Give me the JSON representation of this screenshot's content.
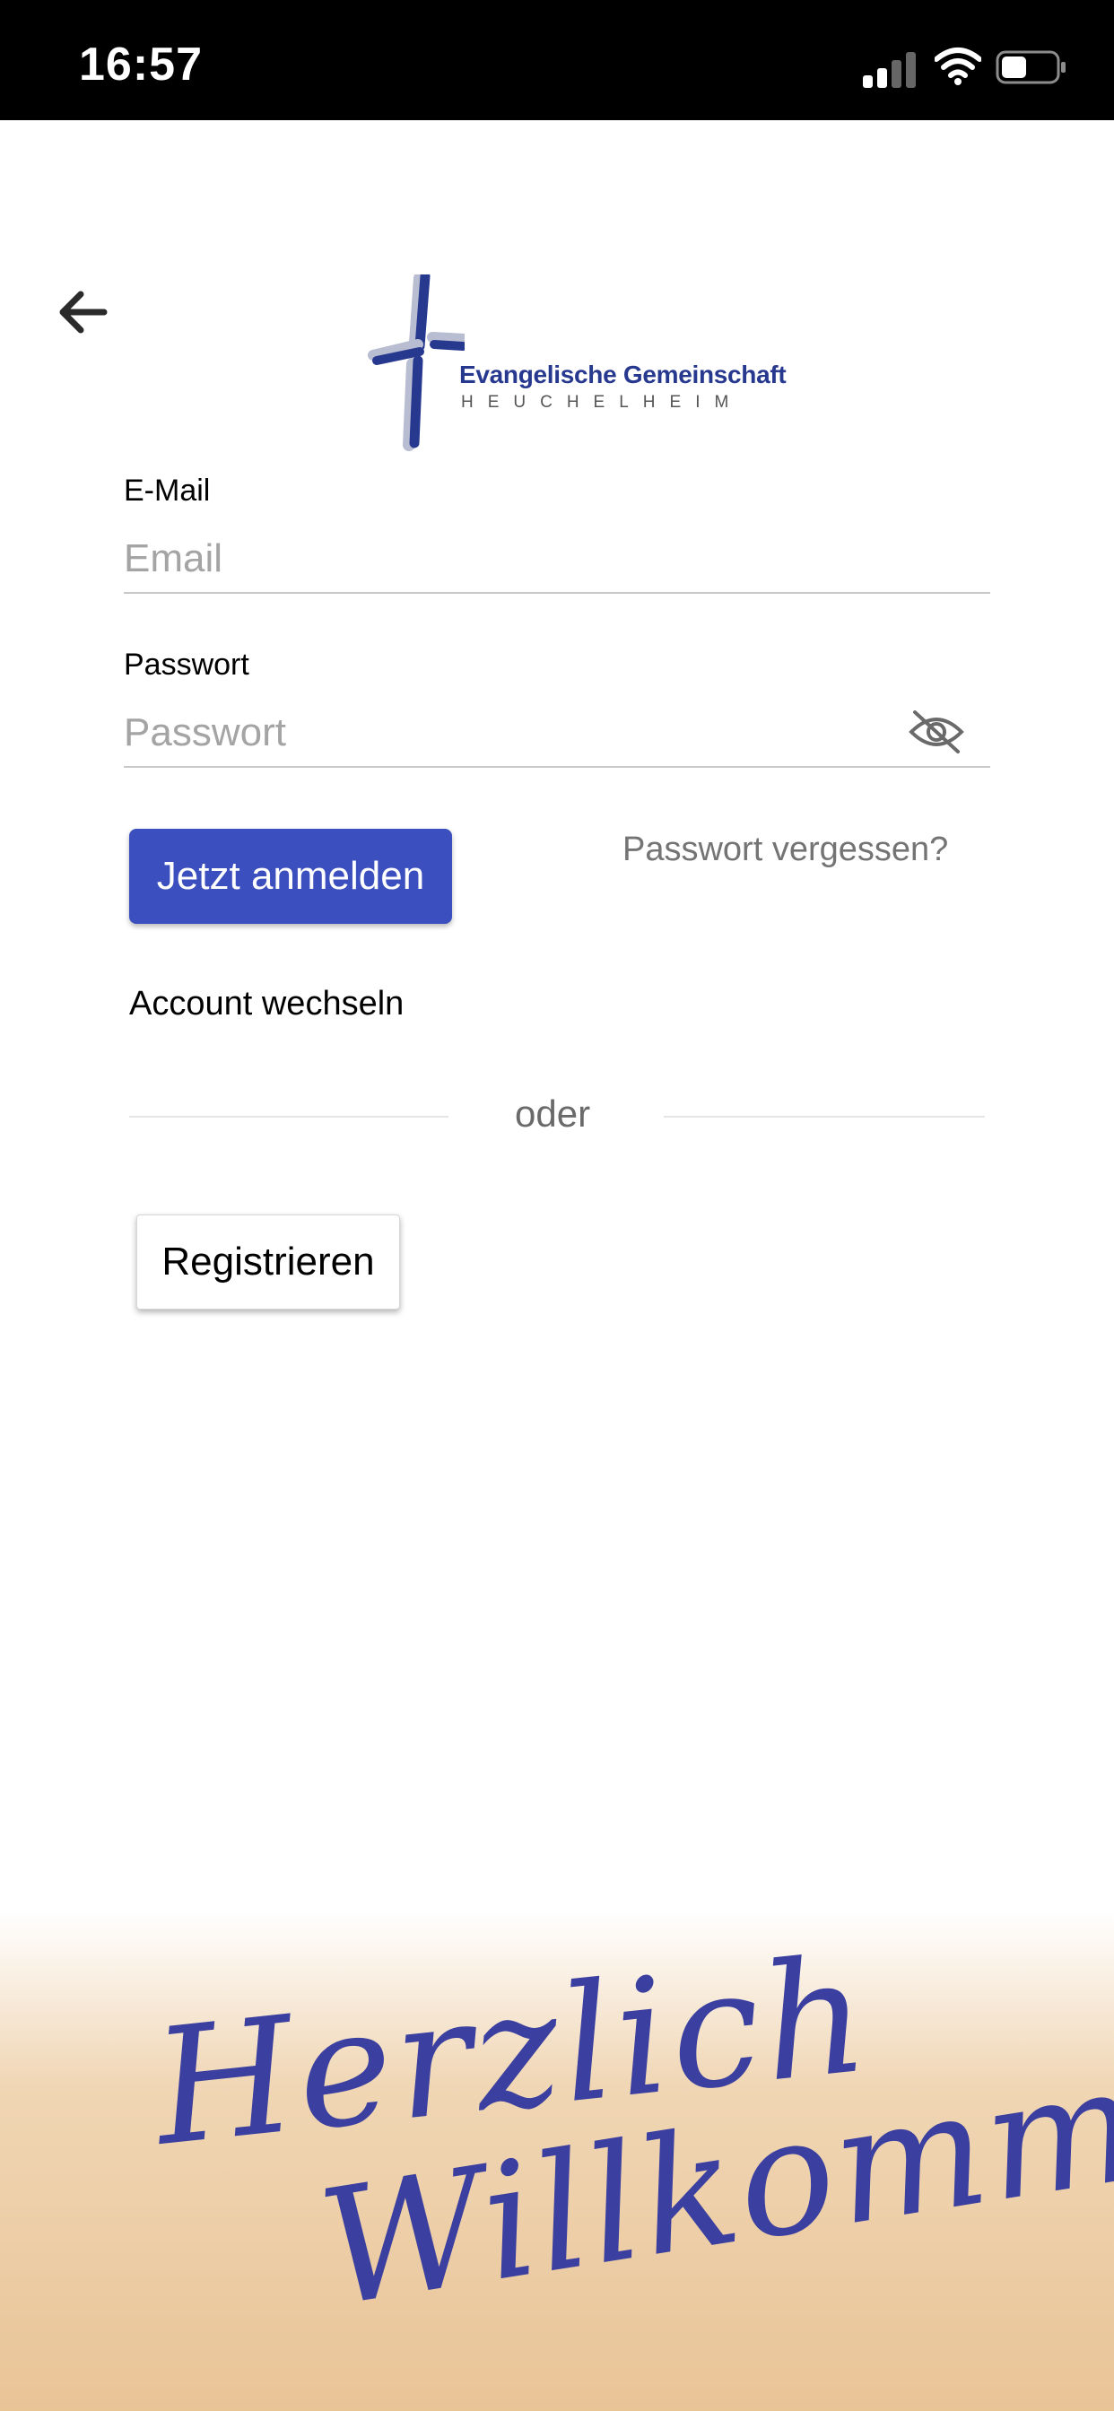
{
  "status_bar": {
    "time": "16:57",
    "icons": [
      "signal-icon",
      "wifi-icon",
      "battery-icon"
    ]
  },
  "header": {
    "back_icon": "arrow-left-icon",
    "logo": {
      "title": "Evangelische Gemeinschaft",
      "subtitle": "HEUCHELHEIM"
    }
  },
  "form": {
    "email": {
      "label": "E-Mail",
      "placeholder": "Email",
      "value": ""
    },
    "password": {
      "label": "Passwort",
      "placeholder": "Passwort",
      "value": "",
      "visibility_icon": "eye-off-icon"
    },
    "login_label": "Jetzt anmelden",
    "forgot_label": "Passwort vergessen?",
    "switch_account_label": "Account wechseln",
    "divider_label": "oder",
    "register_label": "Registrieren"
  },
  "banner": {
    "text_line1": "Herzlich",
    "text_line2": "Willkommen!"
  },
  "colors": {
    "primary_button": "#3c4fbf",
    "brand_blue": "#27388f",
    "banner_sand": "#e9c497",
    "script_ink": "#3a3fa0"
  }
}
